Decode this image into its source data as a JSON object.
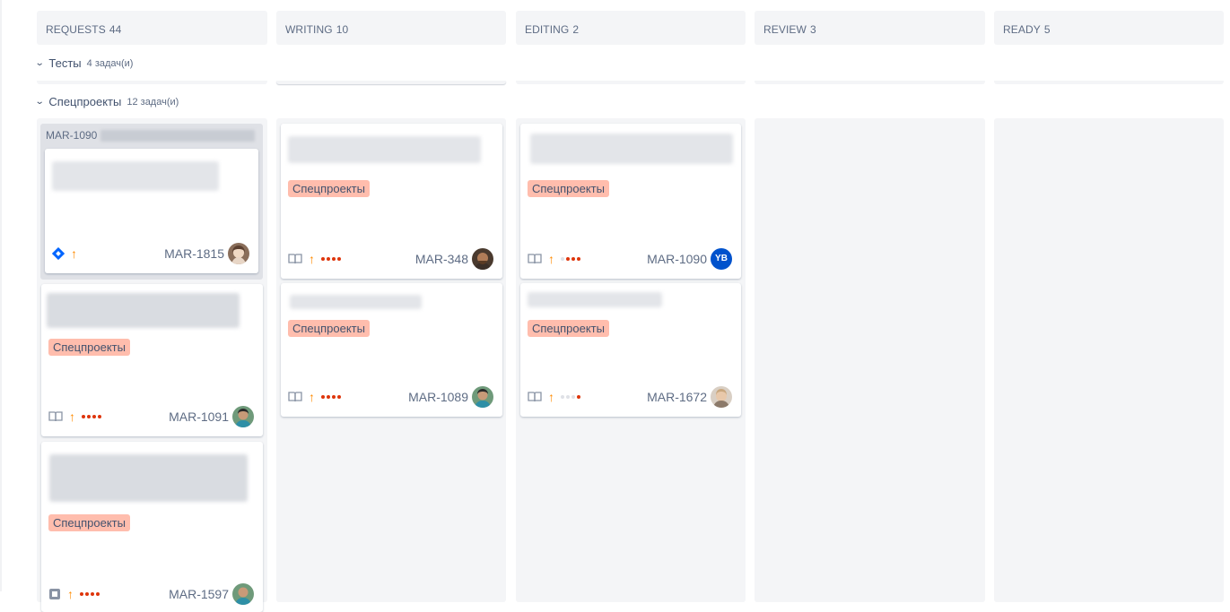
{
  "columns": [
    {
      "name": "REQUESTS",
      "count": "44"
    },
    {
      "name": "WRITING",
      "count": "10"
    },
    {
      "name": "EDITING",
      "count": "2"
    },
    {
      "name": "REVIEW",
      "count": "3"
    },
    {
      "name": "READY",
      "count": "5"
    }
  ],
  "swimlanes": [
    {
      "name": "Тесты",
      "count": "4 задач(и)"
    },
    {
      "name": "Спецпроекты",
      "count": "12 задач(и)"
    }
  ],
  "parent": {
    "key": "MAR-1090"
  },
  "cards": {
    "req1": {
      "key": "MAR-1815"
    },
    "req2": {
      "label": "Спецпроекты",
      "key": "MAR-1091"
    },
    "req3": {
      "label": "Спецпроекты",
      "key": "MAR-1597"
    },
    "wri1": {
      "label": "Спецпроекты",
      "key": "MAR-348"
    },
    "wri2": {
      "label": "Спецпроекты",
      "key": "MAR-1089"
    },
    "edi1": {
      "label": "Спецпроекты",
      "key": "MAR-1090",
      "avatar_initials": "YB"
    },
    "edi2": {
      "label": "Спецпроекты",
      "key": "MAR-1672"
    }
  },
  "colors": {
    "label_bg": "#ffbdad",
    "priority": "#ff8b00",
    "dots": "#de350b",
    "avatar_blue": "#0052cc"
  }
}
